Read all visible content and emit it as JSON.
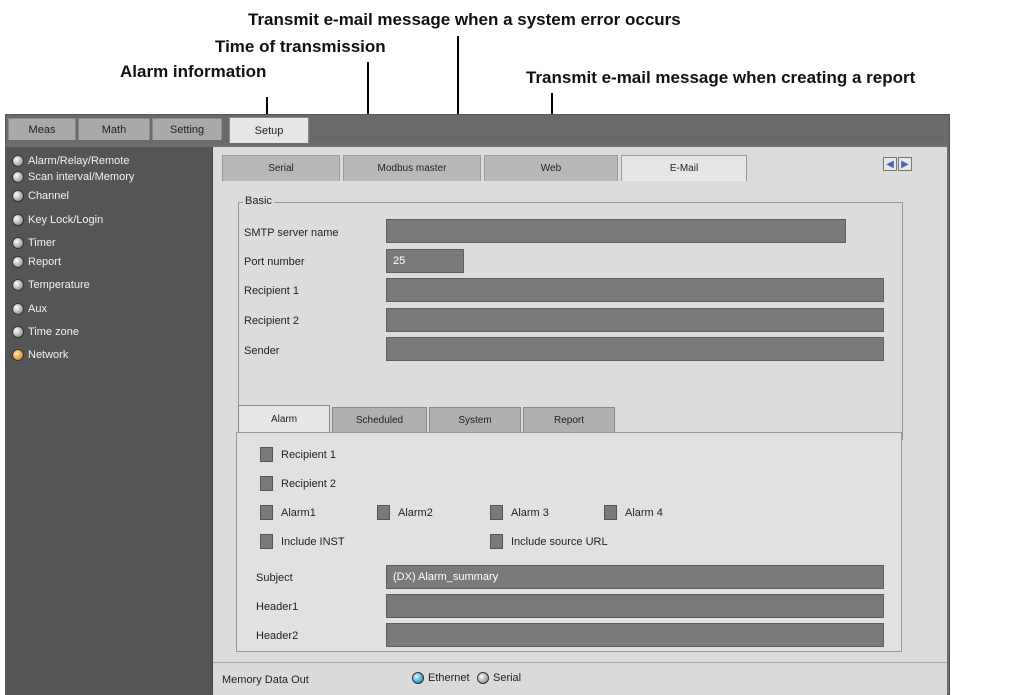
{
  "callouts": {
    "system_error": "Transmit e-mail message when a system error occurs",
    "time_of_transmission": "Time of transmission",
    "alarm_information": "Alarm information",
    "creating_report": "Transmit e-mail message when creating a report"
  },
  "top_tabs": [
    "Meas",
    "Math",
    "Setting",
    "Setup"
  ],
  "sidebar": {
    "items": [
      "Alarm/Relay/Remote",
      "Scan interval/Memory",
      "Channel",
      "Key Lock/Login",
      "Timer",
      "Report",
      "Temperature",
      "Aux",
      "Time zone",
      "Network"
    ],
    "selected": "Network"
  },
  "sub_tabs": [
    "Serial",
    "Modbus master",
    "Web",
    "E-Mail"
  ],
  "basic": {
    "legend": "Basic",
    "smtp_label": "SMTP server name",
    "smtp_value": "",
    "port_label": "Port number",
    "port_value": "25",
    "recipient1_label": "Recipient 1",
    "recipient2_label": "Recipient 2",
    "sender_label": "Sender"
  },
  "email_tabs": [
    "Alarm",
    "Scheduled",
    "System",
    "Report"
  ],
  "alarm": {
    "recipient1": "Recipient 1",
    "recipient2": "Recipient 2",
    "alarm1": "Alarm1",
    "alarm2": "Alarm2",
    "alarm3": "Alarm 3",
    "alarm4": "Alarm 4",
    "include_inst": "Include INST",
    "include_url": "Include source URL",
    "subject_label": "Subject",
    "subject_value": "(DX) Alarm_summary",
    "header1_label": "Header1",
    "header2_label": "Header2"
  },
  "footer": {
    "label": "Memory Data Out",
    "ethernet": "Ethernet",
    "serial": "Serial",
    "selected": "Ethernet"
  },
  "colors": {
    "panel_bg": "#dcdcdc",
    "field_bg": "#7a7a7a",
    "sidebar_bg": "#555555",
    "selected_radio": "#e8a040"
  }
}
